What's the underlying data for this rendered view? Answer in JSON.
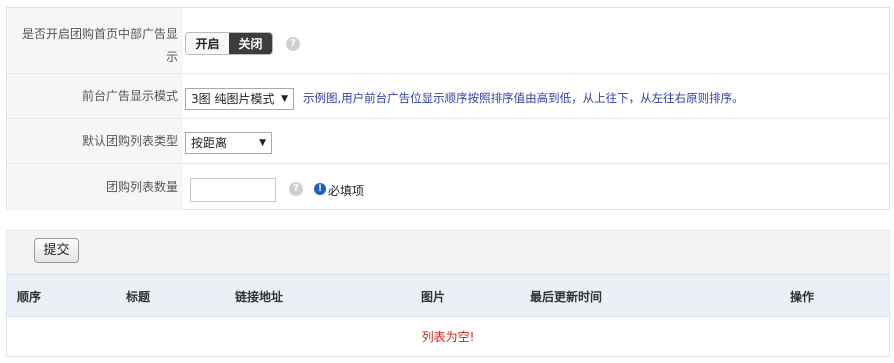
{
  "form": {
    "rows": [
      {
        "label_line1": "是否开启团购首页中部广告显",
        "label_line2": "示",
        "toggle_on": "开启",
        "toggle_off": "关闭",
        "help": "?"
      },
      {
        "label": "前台广告显示模式",
        "select_value": "3图 纯图片模式",
        "hint": "示例图,用户前台广告位显示顺序按照排序值由高到低，从上往下，从左往右原则排序。"
      },
      {
        "label": "默认团购列表类型",
        "select_value": "按距离"
      },
      {
        "label": "团购列表数量",
        "help": "?",
        "required_icon": "!",
        "required_text": "必填项"
      }
    ]
  },
  "toolbar": {
    "submit_label": "提交"
  },
  "table": {
    "columns": [
      "顺序",
      "标题",
      "链接地址",
      "图片",
      "最后更新时间",
      "操作"
    ],
    "empty_text": "列表为空!"
  }
}
